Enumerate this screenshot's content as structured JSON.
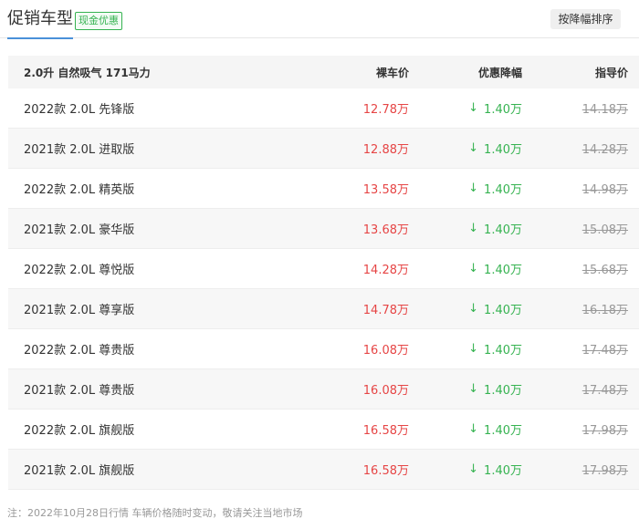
{
  "header": {
    "title": "促销车型",
    "badge": "现金优惠",
    "sort_button": "按降幅排序"
  },
  "table": {
    "group_label": "2.0升 自然吸气 171马力",
    "columns": {
      "price": "裸车价",
      "discount": "优惠降幅",
      "guide": "指导价"
    },
    "rows": [
      {
        "name": "2022款 2.0L 先锋版",
        "price": "12.78万",
        "discount": "1.40万",
        "guide": "14.18万"
      },
      {
        "name": "2021款 2.0L 进取版",
        "price": "12.88万",
        "discount": "1.40万",
        "guide": "14.28万"
      },
      {
        "name": "2022款 2.0L 精英版",
        "price": "13.58万",
        "discount": "1.40万",
        "guide": "14.98万"
      },
      {
        "name": "2021款 2.0L 豪华版",
        "price": "13.68万",
        "discount": "1.40万",
        "guide": "15.08万"
      },
      {
        "name": "2022款 2.0L 尊悦版",
        "price": "14.28万",
        "discount": "1.40万",
        "guide": "15.68万"
      },
      {
        "name": "2021款 2.0L 尊享版",
        "price": "14.78万",
        "discount": "1.40万",
        "guide": "16.18万"
      },
      {
        "name": "2022款 2.0L 尊贵版",
        "price": "16.08万",
        "discount": "1.40万",
        "guide": "17.48万"
      },
      {
        "name": "2021款 2.0L 尊贵版",
        "price": "16.08万",
        "discount": "1.40万",
        "guide": "17.48万"
      },
      {
        "name": "2022款 2.0L 旗舰版",
        "price": "16.58万",
        "discount": "1.40万",
        "guide": "17.98万"
      },
      {
        "name": "2021款 2.0L 旗舰版",
        "price": "16.58万",
        "discount": "1.40万",
        "guide": "17.98万"
      }
    ]
  },
  "footer": {
    "note": "注：2022年10月28日行情 车辆价格随时变动，敬请关注当地市场"
  },
  "icons": {
    "discount": "down-arrow-icon"
  },
  "colors": {
    "price": "#e64545",
    "discount": "#36b351",
    "guide": "#999999",
    "accent": "#4a90d9"
  }
}
